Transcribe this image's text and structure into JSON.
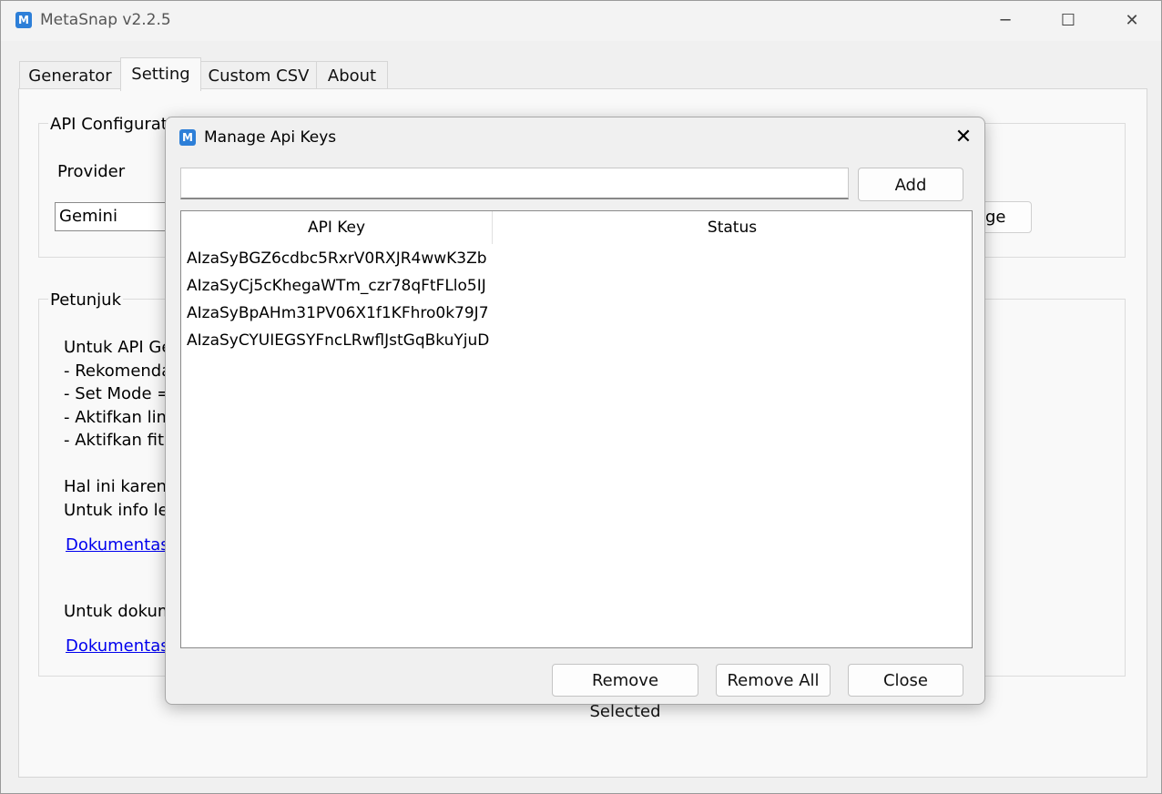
{
  "window": {
    "title": "MetaSnap v2.2.5",
    "logo": "M",
    "controls": {
      "minimize": "─",
      "maximize": "☐",
      "close": "✕"
    }
  },
  "tabs": [
    {
      "label": "Generator"
    },
    {
      "label": "Setting",
      "active": true
    },
    {
      "label": "Custom CSV"
    },
    {
      "label": "About"
    }
  ],
  "settings": {
    "api_config": {
      "title": "API Configurati",
      "provider_label": "Provider",
      "provider_value": "Gemini",
      "button_partial": "ge"
    },
    "petunjuk": {
      "title": "Petunjuk",
      "lines": [
        "Untuk API Ge",
        "- Rekomenda",
        "- Set Mode =",
        "- Aktifkan lim",
        "- Aktifkan fitu"
      ],
      "lines2": [
        "Hal ini karena",
        "Untuk info le"
      ],
      "link1": "Dokumentasi",
      "line3": "Untuk dokum",
      "link2": "Dokumentasi"
    }
  },
  "dialog": {
    "title": "Manage Api Keys",
    "logo": "M",
    "close_glyph": "✕",
    "input": {
      "value": "",
      "placeholder": ""
    },
    "add_label": "Add",
    "table": {
      "headers": [
        "API Key",
        "Status"
      ],
      "rows": [
        {
          "key": "AIzaSyBGZ6cdbc5RxrV0RXJR4wwK3Zb",
          "status": ""
        },
        {
          "key": "AIzaSyCj5cKhegaWTm_czr78qFtFLlo5IJ",
          "status": ""
        },
        {
          "key": "AIzaSyBpAHm31PV06X1f1KFhro0k79J7",
          "status": ""
        },
        {
          "key": "AIzaSyCYUIEGSYFncLRwflJstGqBkuYjuD",
          "status": ""
        }
      ]
    },
    "remove_selected_label": "Remove Selected",
    "remove_all_label": "Remove All",
    "close_label": "Close"
  }
}
